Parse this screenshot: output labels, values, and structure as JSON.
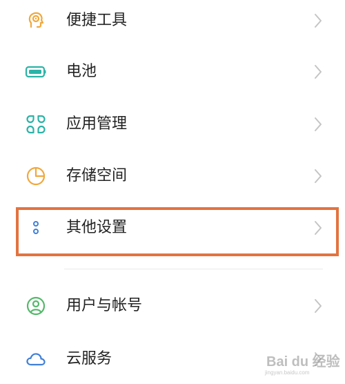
{
  "menu": {
    "items": [
      {
        "label": "便捷工具",
        "icon": "convenience-tools-icon"
      },
      {
        "label": "电池",
        "icon": "battery-icon"
      },
      {
        "label": "应用管理",
        "icon": "app-management-icon"
      },
      {
        "label": "存储空间",
        "icon": "storage-icon"
      },
      {
        "label": "其他设置",
        "icon": "other-settings-icon",
        "highlighted": true
      },
      {
        "label": "用户与帐号",
        "icon": "user-account-icon"
      },
      {
        "label": "云服务",
        "icon": "cloud-icon"
      }
    ]
  },
  "watermark": {
    "text": "Bai du 经验",
    "sub": "jingyan.baidu.com"
  },
  "colors": {
    "highlight_border": "#e2733f",
    "icon_orange": "#f0a83c",
    "icon_teal": "#2bb3a7",
    "icon_green": "#54b86a",
    "icon_blue": "#3f7fd8"
  }
}
